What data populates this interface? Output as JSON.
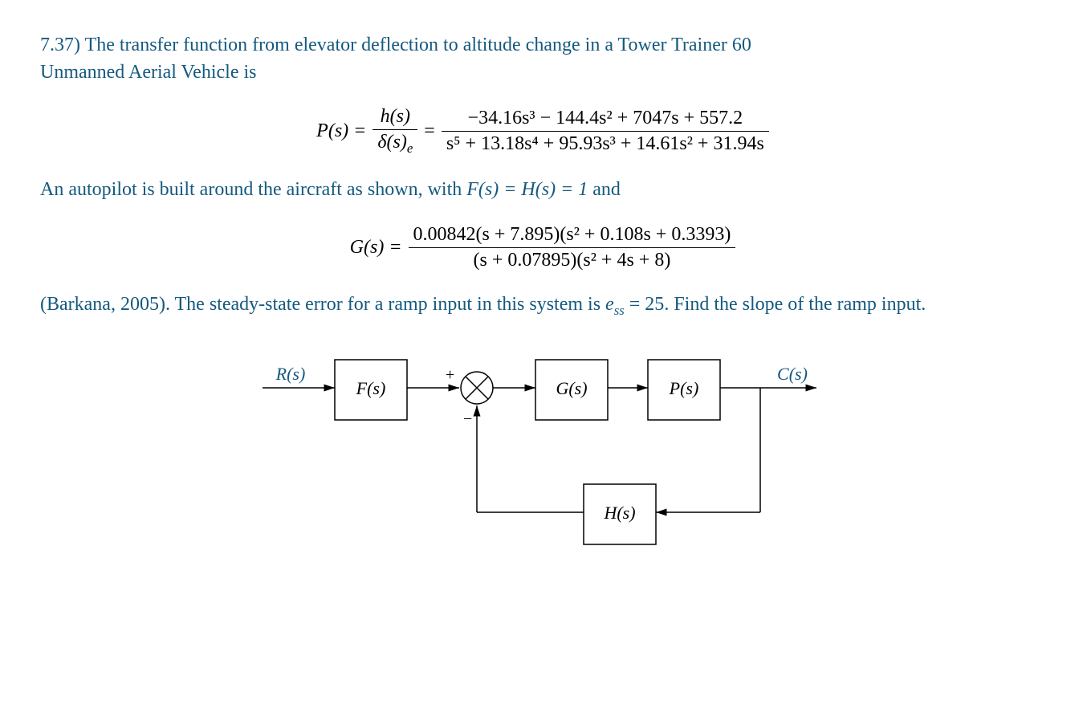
{
  "problem": {
    "number": "7.37)",
    "intro_line1": "The transfer function from elevator deflection to altitude change in a Tower Trainer 60",
    "intro_line2": "Unmanned Aerial Vehicle is",
    "P_label": "P(s) = ",
    "P_frac_hs_num": "h(s)",
    "P_frac_hs_den_delta": "δ(s)",
    "P_frac_hs_den_sub": "e",
    "equals": " = ",
    "P_num": "−34.16s³ − 144.4s² + 7047s + 557.2",
    "P_den": "s⁵ + 13.18s⁴ + 95.93s³ + 14.61s² + 31.94s",
    "mid_text": "An autopilot is built around the aircraft as shown, with ",
    "FH_eq": "F(s) = H(s) = 1",
    "and_word": " and",
    "G_label": "G(s) = ",
    "G_num": "0.00842(s + 7.895)(s² + 0.108s + 0.3393)",
    "G_den": "(s + 0.07895)(s² + 4s + 8)",
    "ref": "(Barkana, 2005). The steady-state error for a ramp input in this system is ",
    "ess_label": "e",
    "ess_sub": "ss",
    "ess_value": " = 25",
    "final": ". Find the slope of the ramp input."
  },
  "diagram": {
    "R": "R(s)",
    "F": "F(s)",
    "G": "G(s)",
    "P": "P(s)",
    "H": "H(s)",
    "C": "C(s)",
    "plus": "+",
    "minus": "−"
  }
}
